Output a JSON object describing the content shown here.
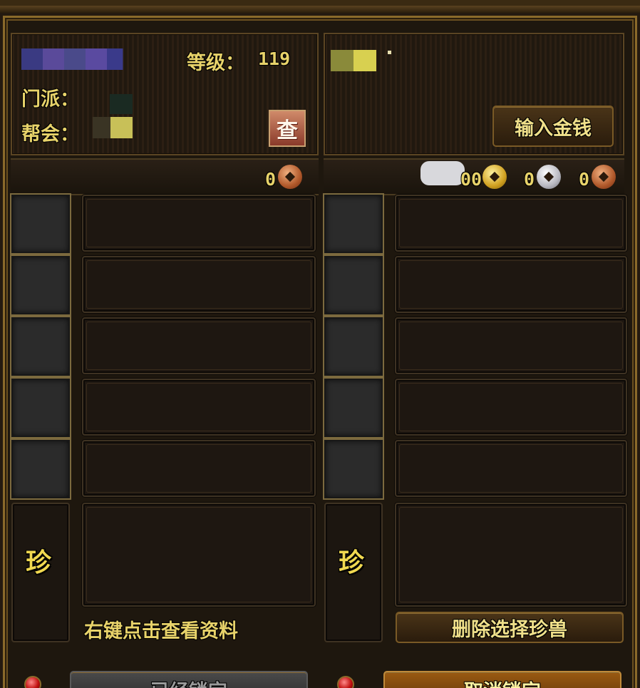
{
  "left": {
    "level_label": "等级：",
    "level_value": "119",
    "sect_label": "门派：",
    "guild_label": "帮会：",
    "look_button": "查",
    "copper_amount": "0",
    "treasure_glyph": "珍",
    "hint_text": "右键点击查看资料",
    "lock_button": "已经锁定"
  },
  "right": {
    "input_money_button": "输入金钱",
    "gold_amount": "00",
    "silver_amount": "0",
    "copper_amount": "0",
    "treasure_glyph": "珍",
    "delete_pet_button": "删除选择珍兽",
    "cancel_lock_button": "取消锁定"
  },
  "colors": {
    "text_gold": "#e8d36a",
    "frame_border": "#8a6a2a"
  }
}
